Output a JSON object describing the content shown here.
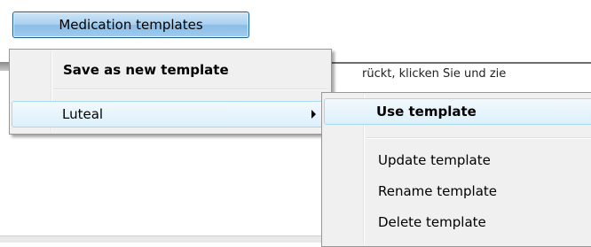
{
  "toolbar": {
    "button_label": "Medication templates"
  },
  "background": {
    "field_text": "rückt, klicken Sie und zie"
  },
  "menu_main": {
    "items": [
      {
        "label": "Save as new template",
        "bold": true
      },
      {
        "label": "Luteal",
        "has_submenu": true
      }
    ]
  },
  "menu_sub": {
    "items": [
      {
        "label": "Use template",
        "bold": true
      },
      {
        "label": "Update template"
      },
      {
        "label": "Rename template"
      },
      {
        "label": "Delete template"
      }
    ]
  },
  "colors": {
    "button_border": "#1f5e8c",
    "highlight_border": "#a8d8eb",
    "menu_background": "#f0f0f0"
  },
  "icons": {
    "submenu_arrow": "chevron-right-icon"
  }
}
